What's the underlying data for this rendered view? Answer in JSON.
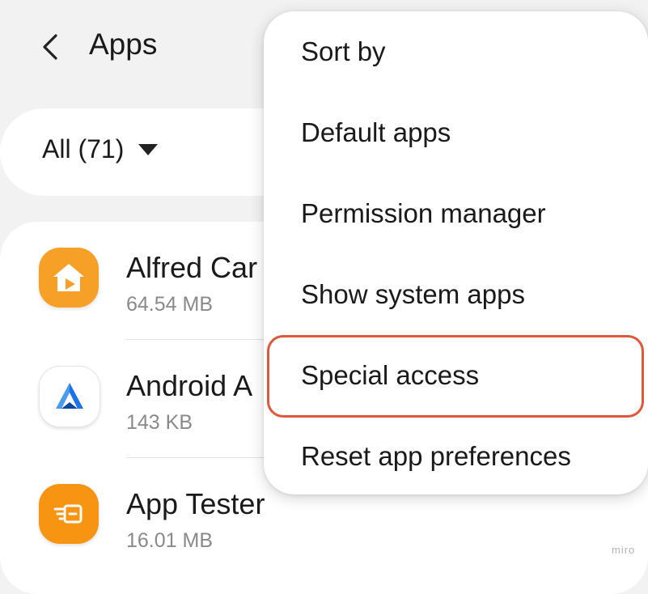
{
  "header": {
    "title": "Apps"
  },
  "filter": {
    "label": "All (71)"
  },
  "apps": [
    {
      "name": "Alfred Car",
      "size": "64.54 MB",
      "icon": "alfred-camera-app-icon",
      "color": "#f7a028"
    },
    {
      "name": "Android A",
      "size": "143 KB",
      "icon": "android-auto-app-icon",
      "color": "#ffffff"
    },
    {
      "name": "App Tester",
      "size": "16.01 MB",
      "icon": "app-tester-app-icon",
      "color": "#f79412"
    }
  ],
  "menu": {
    "items": [
      {
        "label": "Sort by"
      },
      {
        "label": "Default apps"
      },
      {
        "label": "Permission manager"
      },
      {
        "label": "Show system apps"
      },
      {
        "label": "Special access",
        "highlighted": true
      },
      {
        "label": "Reset app preferences"
      }
    ],
    "highlight_color": "#e0573b"
  },
  "watermark": "miro"
}
